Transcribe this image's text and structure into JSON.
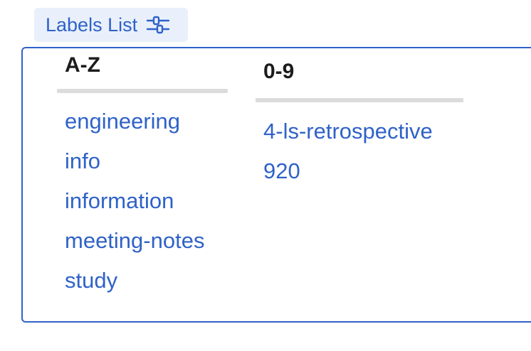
{
  "header": {
    "toggle_label": "Labels List",
    "toggle_icon": "sliders-icon",
    "accent_color": "#2f62c8",
    "toggle_bg_color": "#e9f0fc"
  },
  "columns": {
    "az": {
      "heading": "A-Z",
      "labels": [
        "engineering",
        "info",
        "information",
        "meeting-notes",
        "study"
      ]
    },
    "numeric": {
      "heading": "0-9",
      "labels": [
        "4-ls-retrospective",
        "920"
      ]
    }
  }
}
